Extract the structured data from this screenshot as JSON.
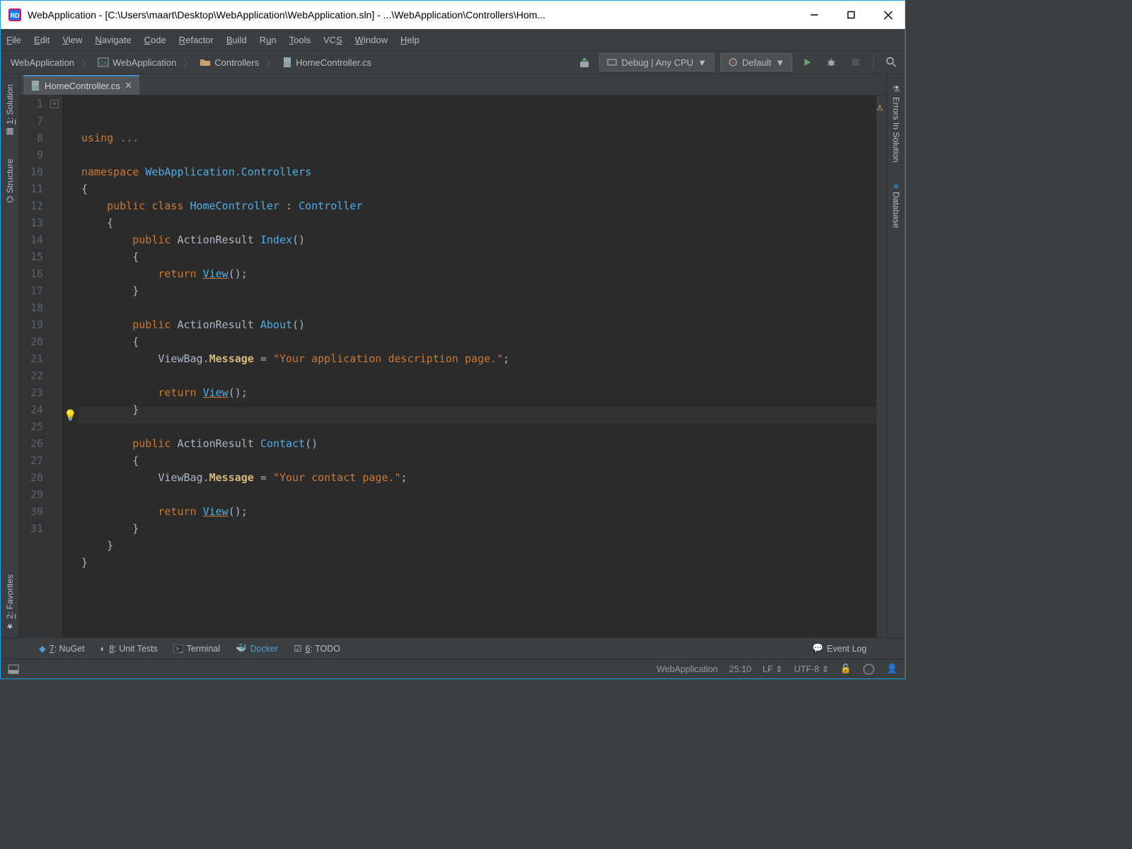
{
  "title": "WebApplication - [C:\\Users\\maart\\Desktop\\WebApplication\\WebApplication.sln] - ...\\WebApplication\\Controllers\\Hom...",
  "menu": [
    "File",
    "Edit",
    "View",
    "Navigate",
    "Code",
    "Refactor",
    "Build",
    "Run",
    "Tools",
    "VCS",
    "Window",
    "Help"
  ],
  "breadcrumbs": [
    "WebApplication",
    "WebApplication",
    "Controllers",
    "HomeController.cs"
  ],
  "run_config": "Debug | Any CPU",
  "target_config": "Default",
  "tab": {
    "label": "HomeController.cs"
  },
  "left_tools": [
    {
      "label": "1: Solution",
      "u": "1"
    },
    {
      "label": "Structure"
    }
  ],
  "right_tools": [
    {
      "label": "Errors In Solution"
    },
    {
      "label": "Database"
    }
  ],
  "left_favorites": "2: Favorites",
  "gutter_lines": [
    "1",
    "7",
    "8",
    "9",
    "10",
    "11",
    "12",
    "13",
    "14",
    "15",
    "16",
    "17",
    "18",
    "19",
    "20",
    "21",
    "22",
    "23",
    "24",
    "25",
    "26",
    "27",
    "28",
    "29",
    "30",
    "31"
  ],
  "code": {
    "l1a": "using ",
    "l1b": "...",
    "l8a": "namespace ",
    "l8b": "WebApplication.Controllers",
    "l9": "{",
    "l10a": "    public class ",
    "l10b": "HomeController",
    "l10c": " : ",
    "l10d": "Controller",
    "l11": "    {",
    "l12a": "        public ",
    "l12b": "ActionResult ",
    "l12c": "Index",
    "l12d": "()",
    "l13": "        {",
    "l14a": "            return ",
    "l14b": "View",
    "l14c": "();",
    "l15": "        }",
    "l17a": "        public ",
    "l17b": "ActionResult ",
    "l17c": "About",
    "l17d": "()",
    "l18": "        {",
    "l19a": "            ViewBag.",
    "l19b": "Message",
    "l19c": " = ",
    "l19d": "\"Your application description page.\"",
    "l19e": ";",
    "l21a": "            return ",
    "l21b": "View",
    "l21c": "();",
    "l22": "        }",
    "l24a": "        public ",
    "l24b": "ActionResult ",
    "l24c": "Contact",
    "l24d": "()",
    "l25": "        {",
    "l26a": "            ViewBag.",
    "l26b": "Message",
    "l26c": " = ",
    "l26d": "\"Your contact page.\"",
    "l26e": ";",
    "l28a": "            return ",
    "l28b": "View",
    "l28c": "();",
    "l29": "        }",
    "l30": "    }",
    "l31": "}"
  },
  "bottom": [
    {
      "label": "7: NuGet",
      "u": "7"
    },
    {
      "label": "8: Unit Tests",
      "u": "8"
    },
    {
      "label": "Terminal"
    },
    {
      "label": "Docker"
    },
    {
      "label": "6: TODO",
      "u": "6"
    }
  ],
  "event_log": "Event Log",
  "status": {
    "context": "WebApplication",
    "pos": "25:10",
    "le": "LF",
    "enc": "UTF-8"
  }
}
